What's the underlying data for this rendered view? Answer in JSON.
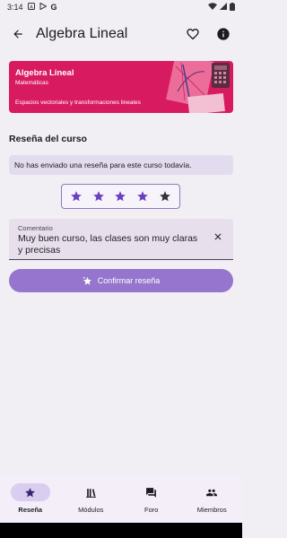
{
  "status_bar": {
    "time": "3:14",
    "icons": [
      "a-icon",
      "play-icon",
      "google-icon"
    ]
  },
  "app_bar": {
    "title": "Algebra Lineal"
  },
  "banner": {
    "title": "Algebra Lineal",
    "subtitle": "Matemáticas",
    "description": "Espacios vectoriales y transformaciones lineales",
    "accent": "#d81b60"
  },
  "review": {
    "section_title": "Reseña del curso",
    "notice": "No has enviado una reseña para este curso todavía.",
    "rating": 4,
    "max_rating": 5,
    "comment_label": "Comentario",
    "comment_value": "Muy buen curso, las clases son muy claras y precisas",
    "confirm_label": "Confirmar reseña"
  },
  "nav": {
    "items": [
      {
        "label": "Reseña",
        "icon": "star-icon",
        "active": true
      },
      {
        "label": "Módulos",
        "icon": "library-icon",
        "active": false
      },
      {
        "label": "Foro",
        "icon": "forum-icon",
        "active": false
      },
      {
        "label": "Miembros",
        "icon": "group-icon",
        "active": false
      }
    ]
  },
  "colors": {
    "primary": "#9575cd",
    "star_filled": "#6a3fc2",
    "star_empty": "#333333"
  }
}
